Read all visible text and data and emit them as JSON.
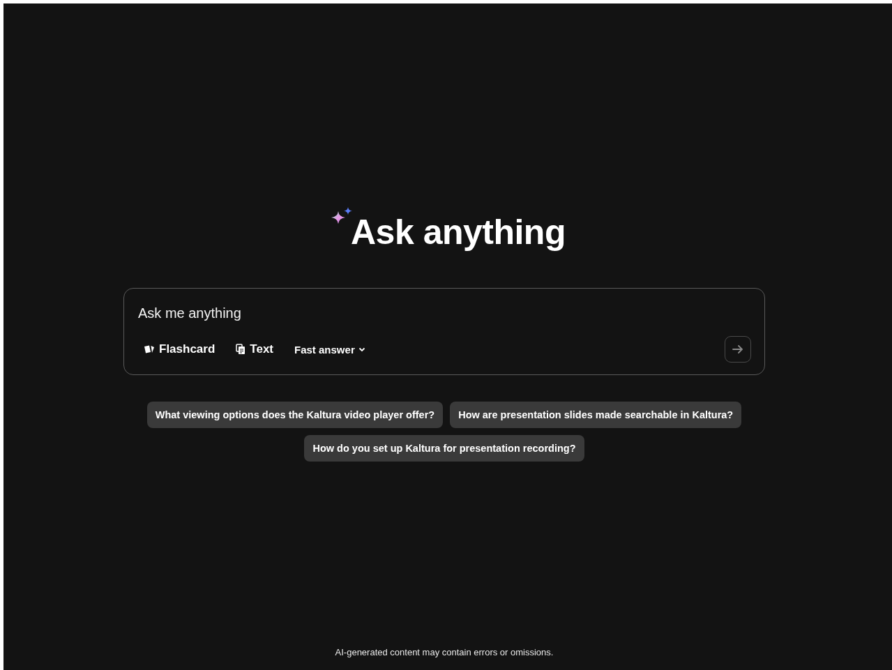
{
  "title": "Ask anything",
  "prompt": {
    "placeholder": "Ask me anything"
  },
  "modes": [
    {
      "kind": "flashcard",
      "label": "Flashcard"
    },
    {
      "kind": "text",
      "label": "Text"
    }
  ],
  "answer_mode": {
    "label": "Fast answer"
  },
  "send_button": {
    "disabled": true
  },
  "suggestions": [
    "What viewing options does the Kaltura video player offer?",
    "How are presentation slides made searchable in Kaltura?",
    "How do you set up Kaltura for presentation recording?"
  ],
  "footer": "AI-generated content may contain errors or omissions."
}
